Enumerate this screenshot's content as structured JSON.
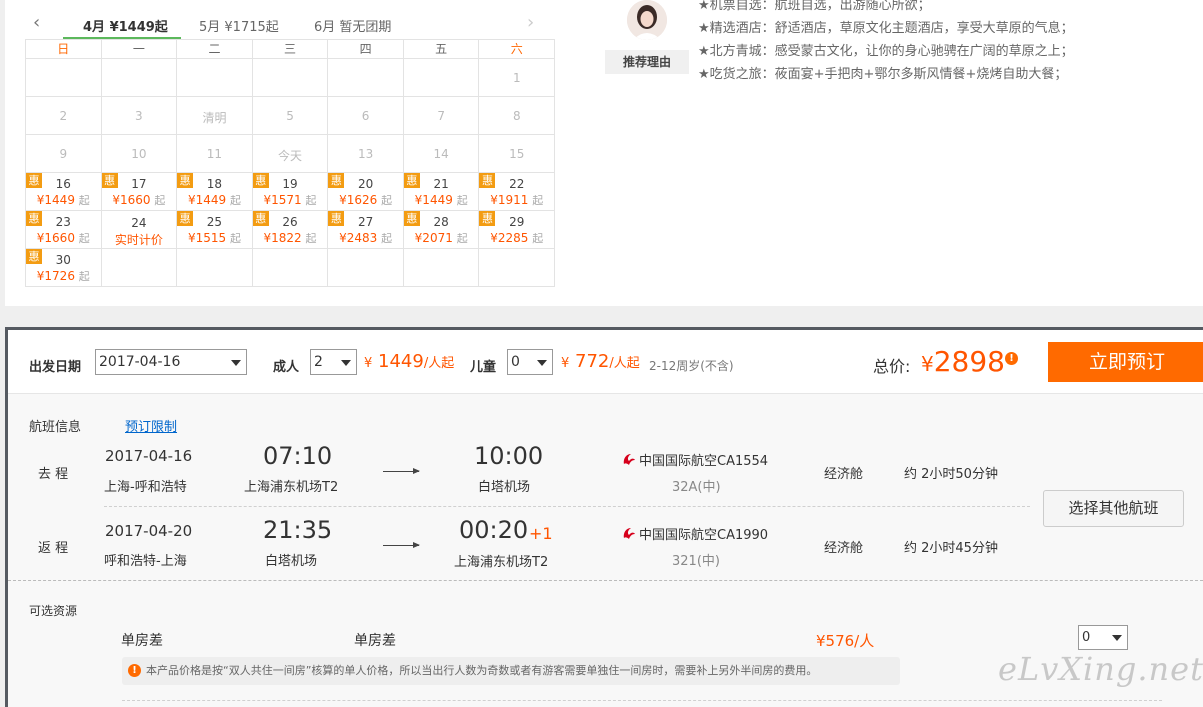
{
  "calendar": {
    "tabs": [
      {
        "label": "4月 ¥1449起"
      },
      {
        "label": "5月 ¥1715起"
      },
      {
        "label": "6月 暂无团期"
      }
    ],
    "weekdays": [
      "日",
      "一",
      "二",
      "三",
      "四",
      "五",
      "六"
    ],
    "hui_label": "惠",
    "qi_label": "起",
    "rows": [
      [
        {
          "d": ""
        },
        {
          "d": ""
        },
        {
          "d": ""
        },
        {
          "d": ""
        },
        {
          "d": ""
        },
        {
          "d": ""
        },
        {
          "d": "1"
        }
      ],
      [
        {
          "d": "2"
        },
        {
          "d": "3"
        },
        {
          "d": "清明"
        },
        {
          "d": "5"
        },
        {
          "d": "6"
        },
        {
          "d": "7"
        },
        {
          "d": "8"
        }
      ],
      [
        {
          "d": "9"
        },
        {
          "d": "10"
        },
        {
          "d": "11"
        },
        {
          "d": "今天"
        },
        {
          "d": "13"
        },
        {
          "d": "14"
        },
        {
          "d": "15"
        }
      ],
      [
        {
          "d": "16",
          "price": "¥1449",
          "hui": true
        },
        {
          "d": "17",
          "price": "¥1660",
          "hui": true
        },
        {
          "d": "18",
          "price": "¥1449",
          "hui": true
        },
        {
          "d": "19",
          "price": "¥1571",
          "hui": true
        },
        {
          "d": "20",
          "price": "¥1626",
          "hui": true
        },
        {
          "d": "21",
          "price": "¥1449",
          "hui": true
        },
        {
          "d": "22",
          "price": "¥1911",
          "hui": true
        }
      ],
      [
        {
          "d": "23",
          "price": "¥1660",
          "hui": true
        },
        {
          "d": "24",
          "realtime": "实时计价"
        },
        {
          "d": "25",
          "price": "¥1515",
          "hui": true
        },
        {
          "d": "26",
          "price": "¥1822",
          "hui": true
        },
        {
          "d": "27",
          "price": "¥2483",
          "hui": true
        },
        {
          "d": "28",
          "price": "¥2071",
          "hui": true
        },
        {
          "d": "29",
          "price": "¥2285",
          "hui": true
        }
      ],
      [
        {
          "d": "30",
          "price": "¥1726",
          "hui": true
        },
        {
          "d": ""
        },
        {
          "d": ""
        },
        {
          "d": ""
        },
        {
          "d": ""
        },
        {
          "d": ""
        },
        {
          "d": ""
        }
      ]
    ]
  },
  "recommend": {
    "label": "推荐理由",
    "items": [
      "★机票自选：航班自选，出游随心所欲；",
      "★精选酒店：舒适酒店，草原文化主题酒店，享受大草原的气息；",
      "★北方青城：感受蒙古文化，让你的身心驰骋在广阔的草原之上；",
      "★吃货之旅：莜面宴+手把肉+鄂尔多斯风情餐+烧烤自助大餐；"
    ]
  },
  "booking": {
    "depart_label": "出发日期",
    "depart_value": "2017-04-16",
    "adult_label": "成人",
    "adult_count": "2",
    "adult_price": "1449",
    "child_label": "儿童",
    "child_count": "0",
    "child_price": "772",
    "yen": "¥",
    "per_person": "/人起",
    "child_note": "2-12周岁(不含)",
    "total_label": "总价:",
    "total_value": "2898",
    "book_button": "立即预订"
  },
  "flights": {
    "section_label": "航班信息",
    "limit_link": "预订限制",
    "other_button": "选择其他航班",
    "items": [
      {
        "dir": "去 程",
        "date": "2017-04-16",
        "route": "上海-呼和浩特",
        "dep_time": "07:10",
        "dep_airport": "上海浦东机场T2",
        "arr_time": "10:00",
        "arr_airport": "白塔机场",
        "plus": "",
        "airline": "中国国际航空CA1554",
        "plane": "32A(中)",
        "cabin": "经济舱",
        "duration": "约 2小时50分钟"
      },
      {
        "dir": "返 程",
        "date": "2017-04-20",
        "route": "呼和浩特-上海",
        "dep_time": "21:35",
        "dep_airport": "白塔机场",
        "arr_time": "00:20",
        "arr_airport": "上海浦东机场T2",
        "plus": "+1",
        "airline": "中国国际航空CA1990",
        "plane": "321(中)",
        "cabin": "经济舱",
        "duration": "约 2小时45分钟"
      }
    ]
  },
  "resources": {
    "section_label": "可选资源",
    "name": "单房差",
    "type": "单房差",
    "price": "¥576/人",
    "qty": "0",
    "notice": "本产品价格是按“双人共住一间房”核算的单人价格，所以当出行人数为奇数或者有游客需要单独住一间房时，需要补上另外半间房的费用。"
  },
  "watermark": "eLvXing.net",
  "colors": {
    "accent": "#ff6a00",
    "price": "#ff5500",
    "tab_underline": "#5cb85c",
    "link": "#0066cc"
  }
}
